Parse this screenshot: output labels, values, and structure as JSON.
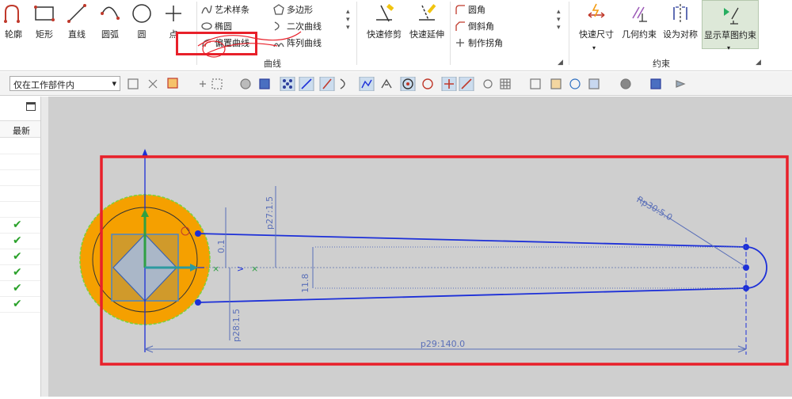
{
  "ribbon": {
    "big_buttons": [
      {
        "id": "profile",
        "label": "轮廓"
      },
      {
        "id": "rectangle",
        "label": "矩形"
      },
      {
        "id": "line",
        "label": "直线"
      },
      {
        "id": "arc",
        "label": "圆弧"
      },
      {
        "id": "circle",
        "label": "圆"
      },
      {
        "id": "point",
        "label": "点"
      }
    ],
    "curve_small": [
      {
        "label": "艺术样条"
      },
      {
        "label": "椭圆"
      },
      {
        "label": "偏置曲线"
      },
      {
        "label": "多边形"
      },
      {
        "label": "二次曲线"
      },
      {
        "label": "阵列曲线"
      }
    ],
    "edit_buttons": [
      {
        "label": "快速修剪"
      },
      {
        "label": "快速延伸"
      }
    ],
    "corner_small": [
      {
        "label": "圆角"
      },
      {
        "label": "倒斜角"
      },
      {
        "label": "制作拐角"
      }
    ],
    "constraint_buttons": [
      {
        "label": "快速尺寸"
      },
      {
        "label": "几何约束"
      },
      {
        "label": "设为对称"
      },
      {
        "label": "显示草图约束"
      }
    ],
    "group_curve": "曲线",
    "group_constraint": "约束"
  },
  "toolbar": {
    "filter_value": "仅在工作部件内"
  },
  "nav": {
    "column_latest": "最新",
    "checks": [
      "✔",
      "✔",
      "✔",
      "✔",
      "✔",
      "✔"
    ]
  },
  "sketch": {
    "dimensions": {
      "p27": "p27:1.5",
      "p28": "p28:1.5",
      "p29": "p29:140.0",
      "p30": "Rp30:5.0",
      "d01": "0.1",
      "d118": "11.8"
    }
  },
  "colors": {
    "highlight_red": "#e8202a",
    "sketch_blue": "#1c2fd8",
    "dim_blue": "#5a6fb8",
    "orange": "#f5a000",
    "canvas_bg": "#cfcfcf"
  }
}
